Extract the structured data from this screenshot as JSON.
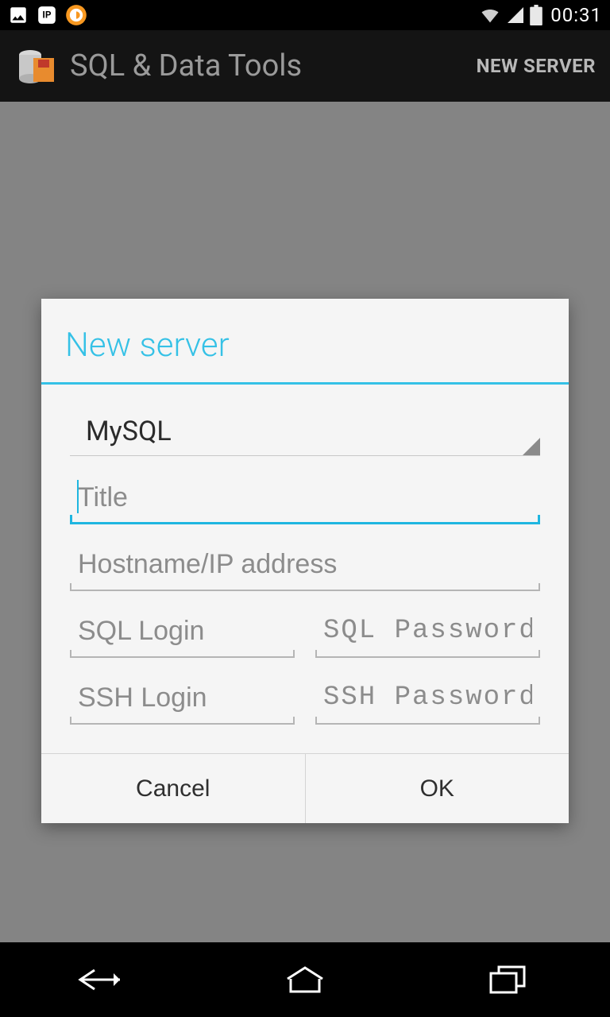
{
  "status_bar": {
    "time": "00:31"
  },
  "app_bar": {
    "title": "SQL & Data Tools",
    "action": "NEW SERVER"
  },
  "dialog": {
    "title": "New server",
    "db_type": "MySQL",
    "fields": {
      "title_placeholder": "Title",
      "host_placeholder": "Hostname/IP address",
      "sql_login_placeholder": "SQL Login",
      "sql_password_placeholder": "SQL Password",
      "ssh_login_placeholder": "SSH Login",
      "ssh_password_placeholder": "SSH Password"
    },
    "buttons": {
      "cancel": "Cancel",
      "ok": "OK"
    }
  }
}
